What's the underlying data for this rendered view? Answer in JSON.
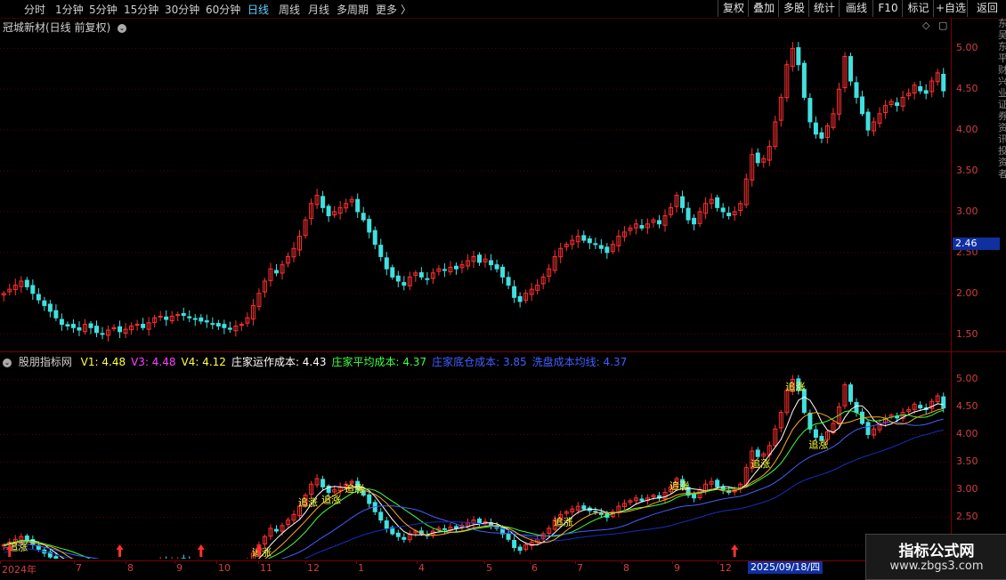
{
  "toolbar": {
    "periods": [
      {
        "label": "分时",
        "active": false
      },
      {
        "label": "1分钟",
        "active": false
      },
      {
        "label": "5分钟",
        "active": false
      },
      {
        "label": "15分钟",
        "active": false
      },
      {
        "label": "30分钟",
        "active": false
      },
      {
        "label": "60分钟",
        "active": false
      },
      {
        "label": "日线",
        "active": true
      },
      {
        "label": "周线",
        "active": false
      },
      {
        "label": "月线",
        "active": false
      },
      {
        "label": "多周期",
        "active": false
      },
      {
        "label": "更多",
        "active": false
      }
    ],
    "more_arrow": "〉",
    "right_buttons": [
      "复权",
      "叠加",
      "多股",
      "统计",
      "画线",
      "F10",
      "标记",
      "+自选",
      "返回"
    ]
  },
  "main_chart": {
    "title": "冠城新材(日线 前复权)",
    "y_ticks": [
      "5.00",
      "4.50",
      "4.00",
      "3.50",
      "3.00",
      "2.50",
      "2.00",
      "1.50"
    ],
    "price_label": "2.46",
    "ctrl_diamond": "◇",
    "ctrl_box": "▢"
  },
  "indicator": {
    "name": "股朋指标网",
    "values": [
      {
        "label": "V1: 4.48",
        "color": "#ffff40"
      },
      {
        "label": "V3: 4.48",
        "color": "#ff40ff"
      },
      {
        "label": "V4: 4.12",
        "color": "#ffff40"
      },
      {
        "label": "庄家运作成本: 4.43",
        "color": "#ffffff"
      },
      {
        "label": "庄家平均成本: 4.37",
        "color": "#40ff40"
      },
      {
        "label": "庄家底仓成本: 3.85",
        "color": "#4060ff"
      },
      {
        "label": "洗盘成本均线: 4.37",
        "color": "#4060ff"
      }
    ],
    "y_ticks": [
      "5.00",
      "4.50",
      "4.00",
      "3.50",
      "3.00",
      "2.50",
      "2.00"
    ],
    "signal_text": "追涨"
  },
  "x_axis": {
    "labels": [
      "2024年",
      "7",
      "8",
      "9",
      "10",
      "11",
      "12",
      "1",
      "4",
      "5",
      "6",
      "7",
      "8",
      "9",
      "12"
    ],
    "cursor_date": "2025/09/18/四"
  },
  "side_strip": [
    "东",
    "吴",
    "东",
    "平",
    "财",
    "兴",
    "业",
    "证",
    "券",
    "资",
    "讯",
    "投",
    "资",
    "者"
  ],
  "watermark": {
    "title": "指标公式网",
    "url": "www.zbgs3.com"
  },
  "chart_data": {
    "type": "candlestick",
    "title": "冠城新材(日线 前复权)",
    "ylim": [
      1.3,
      5.2
    ],
    "close_series": [
      2.0,
      2.05,
      2.1,
      2.15,
      2.08,
      2.0,
      1.92,
      1.85,
      1.78,
      1.7,
      1.62,
      1.6,
      1.58,
      1.55,
      1.62,
      1.58,
      1.52,
      1.5,
      1.55,
      1.58,
      1.53,
      1.56,
      1.6,
      1.62,
      1.58,
      1.64,
      1.7,
      1.72,
      1.68,
      1.72,
      1.74,
      1.73,
      1.7,
      1.68,
      1.66,
      1.65,
      1.63,
      1.6,
      1.58,
      1.56,
      1.6,
      1.62,
      1.7,
      1.85,
      2.0,
      2.15,
      2.3,
      2.25,
      2.35,
      2.45,
      2.55,
      2.7,
      2.9,
      3.1,
      3.2,
      3.05,
      2.95,
      3.0,
      3.05,
      3.1,
      3.15,
      3.0,
      2.9,
      2.75,
      2.6,
      2.45,
      2.3,
      2.2,
      2.15,
      2.1,
      2.2,
      2.25,
      2.2,
      2.18,
      2.25,
      2.3,
      2.28,
      2.32,
      2.3,
      2.35,
      2.4,
      2.45,
      2.38,
      2.42,
      2.35,
      2.3,
      2.2,
      2.1,
      1.95,
      1.9,
      2.0,
      2.05,
      2.1,
      2.2,
      2.3,
      2.45,
      2.55,
      2.6,
      2.65,
      2.7,
      2.65,
      2.62,
      2.6,
      2.55,
      2.5,
      2.6,
      2.7,
      2.75,
      2.8,
      2.85,
      2.8,
      2.85,
      2.9,
      2.85,
      2.95,
      3.05,
      3.2,
      3.05,
      2.9,
      2.85,
      3.0,
      3.1,
      3.15,
      3.05,
      3.0,
      2.95,
      3.0,
      3.1,
      3.4,
      3.7,
      3.6,
      3.65,
      3.8,
      4.1,
      4.4,
      4.8,
      5.0,
      4.8,
      4.4,
      4.1,
      3.95,
      3.9,
      4.05,
      4.2,
      4.5,
      4.9,
      4.6,
      4.4,
      4.2,
      4.0,
      4.1,
      4.2,
      4.3,
      4.35,
      4.3,
      4.4,
      4.45,
      4.55,
      4.48,
      4.45,
      4.6,
      4.7,
      4.48
    ]
  }
}
